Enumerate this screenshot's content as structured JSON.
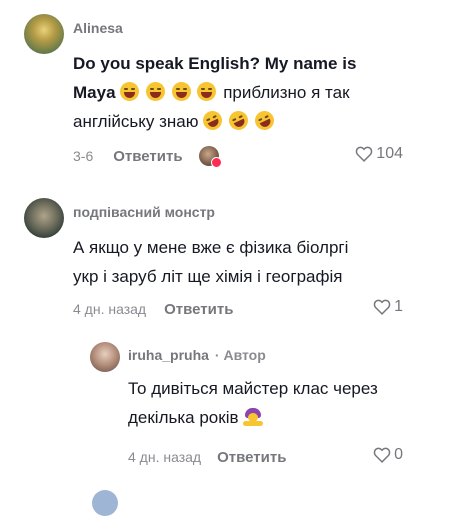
{
  "comments": [
    {
      "username": "Alinesa",
      "text_line1": "Do you speak English? My name is",
      "text_line2_bold": "Maya",
      "text_line2_rest": "приблизно я так",
      "text_line3": "англійську знаю",
      "date": "3-6",
      "reply_label": "Ответить",
      "likes": "104"
    },
    {
      "username": "подпівасний монстр",
      "text_line1": "А якщо у мене вже є фізика біолргі",
      "text_line2": "укр і заруб літ ще хімія і географія",
      "date": "4 дн. назад",
      "reply_label": "Ответить",
      "likes": "1"
    }
  ],
  "reply": {
    "username": "iruha_pruha",
    "author_tag": "· Автор",
    "text_line1": "То дивіться майстер клас через",
    "text_line2": "декілька років",
    "date": "4 дн. назад",
    "reply_label": "Ответить",
    "likes": "0"
  },
  "icons": {
    "like": "heart-outline-icon",
    "emoji_laugh": "face-with-tears-of-joy-icon",
    "emoji_rofl": "rolling-on-floor-laughing-icon",
    "emoji_mem": "person-with-raised-hands-icon"
  },
  "colors": {
    "text": "#161823",
    "muted": "#76777d",
    "like_badge": "#fe2c55"
  }
}
